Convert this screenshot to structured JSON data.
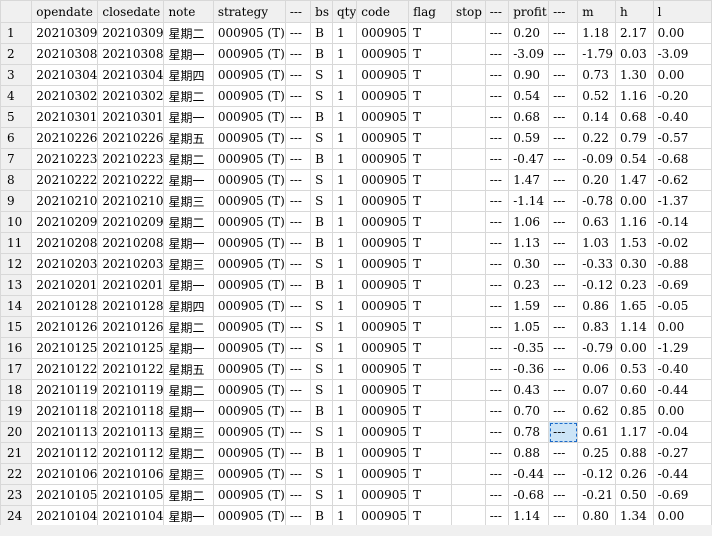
{
  "table": {
    "columns": [
      "",
      "opendate",
      "closedate",
      "note",
      "strategy",
      "---",
      "bs",
      "qty",
      "code",
      "flag",
      "stop",
      "---",
      "profit",
      "---",
      "m",
      "h",
      "l"
    ],
    "rows": [
      [
        "1",
        "20210309",
        "20210309",
        "星期二",
        "000905 (T)",
        "---",
        "B",
        "1",
        "000905",
        "T",
        "",
        "---",
        "0.20",
        "---",
        "1.18",
        "2.17",
        "0.00"
      ],
      [
        "2",
        "20210308",
        "20210308",
        "星期一",
        "000905 (T)",
        "---",
        "B",
        "1",
        "000905",
        "T",
        "",
        "---",
        "-3.09",
        "---",
        "-1.79",
        "0.03",
        "-3.09"
      ],
      [
        "3",
        "20210304",
        "20210304",
        "星期四",
        "000905 (T)",
        "---",
        "S",
        "1",
        "000905",
        "T",
        "",
        "---",
        "0.90",
        "---",
        "0.73",
        "1.30",
        "0.00"
      ],
      [
        "4",
        "20210302",
        "20210302",
        "星期二",
        "000905 (T)",
        "---",
        "S",
        "1",
        "000905",
        "T",
        "",
        "---",
        "0.54",
        "---",
        "0.52",
        "1.16",
        "-0.20"
      ],
      [
        "5",
        "20210301",
        "20210301",
        "星期一",
        "000905 (T)",
        "---",
        "B",
        "1",
        "000905",
        "T",
        "",
        "---",
        "0.68",
        "---",
        "0.14",
        "0.68",
        "-0.40"
      ],
      [
        "6",
        "20210226",
        "20210226",
        "星期五",
        "000905 (T)",
        "---",
        "S",
        "1",
        "000905",
        "T",
        "",
        "---",
        "0.59",
        "---",
        "0.22",
        "0.79",
        "-0.57"
      ],
      [
        "7",
        "20210223",
        "20210223",
        "星期二",
        "000905 (T)",
        "---",
        "B",
        "1",
        "000905",
        "T",
        "",
        "---",
        "-0.47",
        "---",
        "-0.09",
        "0.54",
        "-0.68"
      ],
      [
        "8",
        "20210222",
        "20210222",
        "星期一",
        "000905 (T)",
        "---",
        "S",
        "1",
        "000905",
        "T",
        "",
        "---",
        "1.47",
        "---",
        "0.20",
        "1.47",
        "-0.62"
      ],
      [
        "9",
        "20210210",
        "20210210",
        "星期三",
        "000905 (T)",
        "---",
        "S",
        "1",
        "000905",
        "T",
        "",
        "---",
        "-1.14",
        "---",
        "-0.78",
        "0.00",
        "-1.37"
      ],
      [
        "10",
        "20210209",
        "20210209",
        "星期二",
        "000905 (T)",
        "---",
        "B",
        "1",
        "000905",
        "T",
        "",
        "---",
        "1.06",
        "---",
        "0.63",
        "1.16",
        "-0.14"
      ],
      [
        "11",
        "20210208",
        "20210208",
        "星期一",
        "000905 (T)",
        "---",
        "B",
        "1",
        "000905",
        "T",
        "",
        "---",
        "1.13",
        "---",
        "1.03",
        "1.53",
        "-0.02"
      ],
      [
        "12",
        "20210203",
        "20210203",
        "星期三",
        "000905 (T)",
        "---",
        "S",
        "1",
        "000905",
        "T",
        "",
        "---",
        "0.30",
        "---",
        "-0.33",
        "0.30",
        "-0.88"
      ],
      [
        "13",
        "20210201",
        "20210201",
        "星期一",
        "000905 (T)",
        "---",
        "B",
        "1",
        "000905",
        "T",
        "",
        "---",
        "0.23",
        "---",
        "-0.12",
        "0.23",
        "-0.69"
      ],
      [
        "14",
        "20210128",
        "20210128",
        "星期四",
        "000905 (T)",
        "---",
        "S",
        "1",
        "000905",
        "T",
        "",
        "---",
        "1.59",
        "---",
        "0.86",
        "1.65",
        "-0.05"
      ],
      [
        "15",
        "20210126",
        "20210126",
        "星期二",
        "000905 (T)",
        "---",
        "S",
        "1",
        "000905",
        "T",
        "",
        "---",
        "1.05",
        "---",
        "0.83",
        "1.14",
        "0.00"
      ],
      [
        "16",
        "20210125",
        "20210125",
        "星期一",
        "000905 (T)",
        "---",
        "S",
        "1",
        "000905",
        "T",
        "",
        "---",
        "-0.35",
        "---",
        "-0.79",
        "0.00",
        "-1.29"
      ],
      [
        "17",
        "20210122",
        "20210122",
        "星期五",
        "000905 (T)",
        "---",
        "S",
        "1",
        "000905",
        "T",
        "",
        "---",
        "-0.36",
        "---",
        "0.06",
        "0.53",
        "-0.40"
      ],
      [
        "18",
        "20210119",
        "20210119",
        "星期二",
        "000905 (T)",
        "---",
        "S",
        "1",
        "000905",
        "T",
        "",
        "---",
        "0.43",
        "---",
        "0.07",
        "0.60",
        "-0.44"
      ],
      [
        "19",
        "20210118",
        "20210118",
        "星期一",
        "000905 (T)",
        "---",
        "B",
        "1",
        "000905",
        "T",
        "",
        "---",
        "0.70",
        "---",
        "0.62",
        "0.85",
        "0.00"
      ],
      [
        "20",
        "20210113",
        "20210113",
        "星期三",
        "000905 (T)",
        "---",
        "S",
        "1",
        "000905",
        "T",
        "",
        "---",
        "0.78",
        "---",
        "0.61",
        "1.17",
        "-0.04"
      ],
      [
        "21",
        "20210112",
        "20210112",
        "星期二",
        "000905 (T)",
        "---",
        "B",
        "1",
        "000905",
        "T",
        "",
        "---",
        "0.88",
        "---",
        "0.25",
        "0.88",
        "-0.27"
      ],
      [
        "22",
        "20210106",
        "20210106",
        "星期三",
        "000905 (T)",
        "---",
        "S",
        "1",
        "000905",
        "T",
        "",
        "---",
        "-0.44",
        "---",
        "-0.12",
        "0.26",
        "-0.44"
      ],
      [
        "23",
        "20210105",
        "20210105",
        "星期二",
        "000905 (T)",
        "---",
        "S",
        "1",
        "000905",
        "T",
        "",
        "---",
        "-0.68",
        "---",
        "-0.21",
        "0.50",
        "-0.69"
      ],
      [
        "24",
        "20210104",
        "20210104",
        "星期一",
        "000905 (T)",
        "---",
        "B",
        "1",
        "000905",
        "T",
        "",
        "---",
        "1.14",
        "---",
        "0.80",
        "1.34",
        "0.00"
      ]
    ],
    "selected_cell": {
      "row": 19,
      "col": 13
    }
  },
  "colors": {
    "header_bg": "#f0f0f0",
    "grid_line": "#d8d8d8",
    "selection": "#cce4f7"
  }
}
